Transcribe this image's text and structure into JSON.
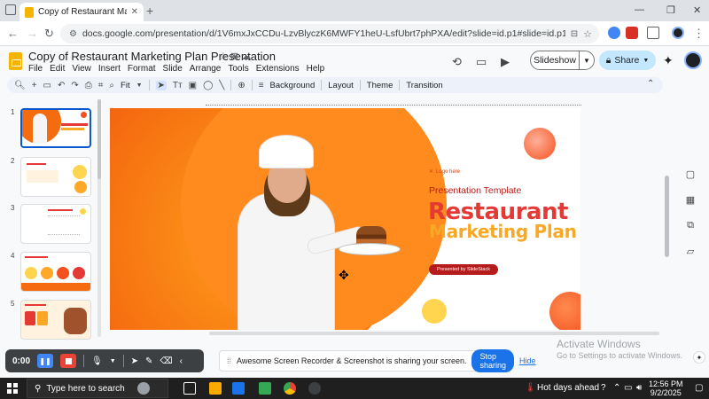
{
  "browser": {
    "tab_title": "Copy of Restaurant Marketing P",
    "new_tab_icon": "plus-icon",
    "url": "docs.google.com/presentation/d/1V6mxJxCCDu-LzvBlyczK6MWFY1heU-LsfUbrt7phPXA/edit?slide=id.p1#slide=id.p1",
    "window_controls": [
      "—",
      "❐",
      "✕"
    ]
  },
  "docs": {
    "title": "Copy of Restaurant Marketing Plan Presentation",
    "menu": [
      "File",
      "Edit",
      "View",
      "Insert",
      "Format",
      "Slide",
      "Arrange",
      "Tools",
      "Extensions",
      "Help"
    ],
    "slideshow_label": "Slideshow",
    "share_label": "Share"
  },
  "toolbar": {
    "zoom": "Fit",
    "background": "Background",
    "layout": "Layout",
    "theme": "Theme",
    "transition": "Transition"
  },
  "filmstrip": {
    "numbers": [
      "1",
      "2",
      "3",
      "4",
      "5"
    ]
  },
  "slide": {
    "logo_text": "Logo here",
    "subtitle": "Presentation Template",
    "title_line1": "Restaurant",
    "title_line2": "Marketing Plan",
    "presented_by": "Presented by SlideStack"
  },
  "recorder": {
    "time": "0:00"
  },
  "sharebar": {
    "message": "Awesome Screen Recorder & Screenshot is sharing your screen.",
    "stop_label": "Stop sharing",
    "hide_label": "Hide"
  },
  "watermark": {
    "line1": "Activate Windows",
    "line2": "Go to Settings to activate Windows."
  },
  "taskbar": {
    "search_placeholder": "Type here to search",
    "weather": "Hot days ahead",
    "time": "12:56 PM",
    "date": "9/2/2025"
  },
  "colors": {
    "accent_blue": "#0b57d0",
    "title_red": "#e53935",
    "title_yellow": "#f9a825",
    "slide_orange": "#f56b10"
  }
}
